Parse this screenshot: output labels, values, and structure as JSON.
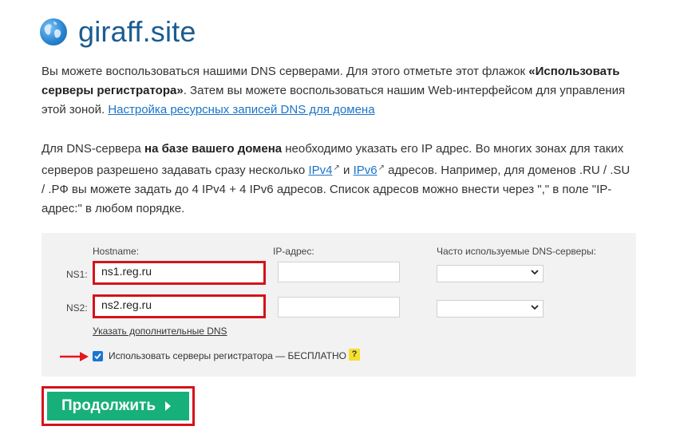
{
  "site": {
    "title": "giraff.site"
  },
  "paragraph1": {
    "t1": "Вы можете воспользоваться нашими DNS серверами. Для этого отметьте этот флажок ",
    "bold": "«Использовать серверы регистратора»",
    "t2": ". Затем вы можете воспользоваться нашим Web-интерфейсом для управления этой зоной. ",
    "link": "Настройка ресурсных записей DNS для домена"
  },
  "paragraph2": {
    "t1": "Для DNS-сервера ",
    "bold": "на базе вашего домена",
    "t2": " необходимо указать его IP адрес. Во многих зонах для таких серверов разрешено задавать сразу несколько ",
    "link_ipv4": "IPv4",
    "t3": " и ",
    "link_ipv6": "IPv6",
    "t4": " адресов. Например, для доменов .RU / .SU / .РФ вы можете задать до 4 IPv4 + 4 IPv6 адресов. Список адресов можно внести через \",\" в поле \"IP-адрес:\" в любом порядке.",
    "ext_mark": "↗"
  },
  "form": {
    "hostname_label": "Hostname:",
    "ip_label": "IP-адрес:",
    "dns_label": "Часто используемые DNS-серверы:",
    "rows": [
      {
        "label": "NS1:",
        "hostname": "ns1.reg.ru",
        "ip": ""
      },
      {
        "label": "NS2:",
        "hostname": "ns2.reg.ru",
        "ip": ""
      }
    ],
    "more_link": "Указать дополнительные DNS",
    "checkbox_label": "Использовать серверы регистратора — БЕСПЛАТНО",
    "checkbox_checked": true,
    "help_mark": "?"
  },
  "submit": {
    "label": "Продолжить"
  },
  "colors": {
    "brand": "#1b5c92",
    "link": "#1a73c8",
    "highlight": "#d4131b",
    "button": "#18b07a",
    "checkbox": "#1976d2",
    "help": "#f5e12b"
  },
  "icons": {
    "logo": "globe-icon",
    "dropdown": "chevron-down-icon",
    "checkmark": "check-icon",
    "button_arrow": "play-arrow-icon",
    "pointer": "red-arrow-icon",
    "external": "external-link-icon"
  }
}
